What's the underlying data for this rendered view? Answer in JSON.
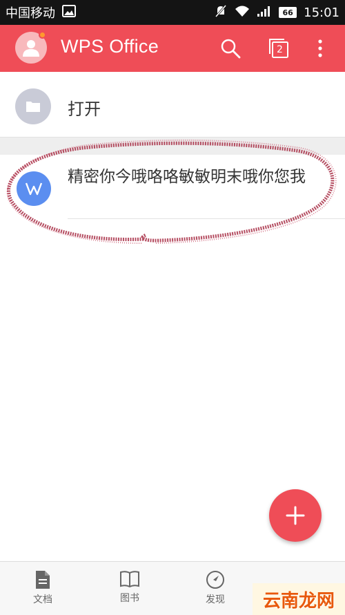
{
  "status_bar": {
    "carrier": "中国移动",
    "battery": "66",
    "time": "15:01",
    "icons": [
      "image-icon",
      "mute-icon",
      "wifi-icon",
      "signal-icon",
      "battery-icon"
    ]
  },
  "header": {
    "title": "WPS Office",
    "tab_count": "2",
    "icons": [
      "avatar-icon",
      "search-icon",
      "tabs-icon",
      "more-vertical-icon"
    ],
    "colors": {
      "accent": "#ef4d57",
      "notification_dot": "#ff9a2e"
    }
  },
  "open_row": {
    "label": "打开",
    "icon": "folder-icon"
  },
  "recent_docs": [
    {
      "title": "精密你今哦咯咯敏敏明末哦你您我",
      "icon": "wps-writer-icon",
      "icon_letter": "W",
      "icon_color": "#5b8ef0"
    }
  ],
  "fab": {
    "icon": "plus-icon"
  },
  "bottom_nav": [
    {
      "label": "文档",
      "icon": "document-icon"
    },
    {
      "label": "图书",
      "icon": "book-icon"
    },
    {
      "label": "发现",
      "icon": "compass-icon"
    }
  ],
  "watermark": {
    "text": "云南龙网"
  }
}
